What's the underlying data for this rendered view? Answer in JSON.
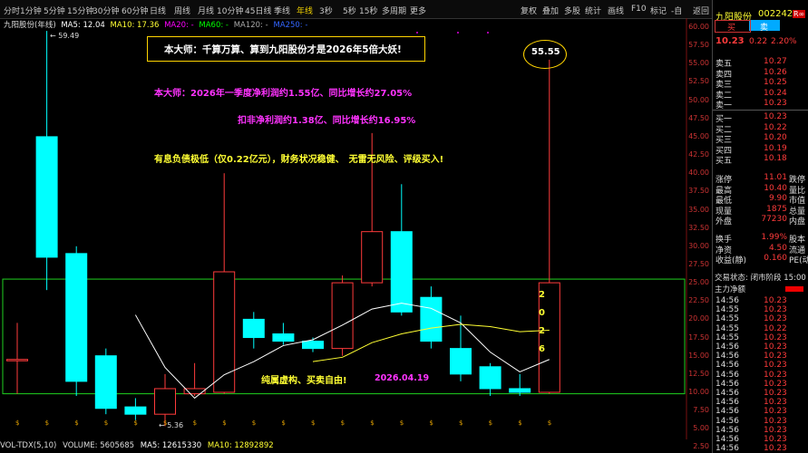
{
  "topbar": {
    "period_tabs": [
      "分时",
      "1分钟",
      "5分钟",
      "15分钟",
      "30分钟",
      "60分钟",
      "日线",
      "周线",
      "月线",
      "10分钟",
      "45日线",
      "季线",
      "年线",
      "3秒",
      "5秒",
      "15秒",
      "多周期",
      "更多"
    ],
    "active_tab": "年线",
    "tools": [
      "复权",
      "叠加",
      "多股",
      "统计",
      "画线",
      "F10",
      "标记",
      "-自",
      "返回"
    ]
  },
  "chart_info": {
    "stock": "九阳股份(年线)",
    "ma5": "MA5: 12.04",
    "ma10": "MA10: 17.36",
    "ma20": "MA20: -",
    "ma60": "MA60: -",
    "ma120": "MA120: -",
    "ma250": "MA250: -"
  },
  "annotations": {
    "headline": "本大师：千算万算、算到九阳股份才是2026年5倍大妖!",
    "line1": "本大师：2026年一季度净利润约1.55亿、同比增长约27.05%",
    "line2": "扣非净利润约1.38亿、同比增长约16.95%",
    "line3": "有息负债极低（仅0.22亿元），财务状况稳健、　无雷无风险、评级买入!",
    "bottom_left": "纯属虚构、买卖自由!",
    "bottom_date": "2026.04.19",
    "target": "55.55",
    "vertical_year": [
      "2",
      "0",
      "2",
      "6"
    ],
    "high_label": "59.49",
    "low_label": "5.36"
  },
  "y_axis": [
    "60.00",
    "57.50",
    "55.00",
    "52.50",
    "50.00",
    "47.50",
    "45.00",
    "42.50",
    "40.00",
    "37.50",
    "35.00",
    "32.50",
    "30.00",
    "27.50",
    "25.00",
    "22.50",
    "20.00",
    "17.50",
    "15.00",
    "12.50",
    "10.00",
    "7.50",
    "5.00",
    "2.50"
  ],
  "chart_data": {
    "type": "candlestick",
    "ylim": [
      2.5,
      60
    ],
    "candles": [
      {
        "o": 14.5,
        "c": 14.5,
        "h": 19.5,
        "l": 9.8
      },
      {
        "o": 45.0,
        "c": 28.5,
        "h": 59.49,
        "l": 24.0
      },
      {
        "o": 29.0,
        "c": 11.5,
        "h": 30.0,
        "l": 9.5
      },
      {
        "o": 15.0,
        "c": 7.8,
        "h": 16.0,
        "l": 7.0
      },
      {
        "o": 8.0,
        "c": 7.0,
        "h": 9.2,
        "l": 6.2
      },
      {
        "o": 7.0,
        "c": 10.5,
        "h": 12.5,
        "l": 5.36
      },
      {
        "o": 9.8,
        "c": 10.5,
        "h": 14.0,
        "l": 9.5
      },
      {
        "o": 10.0,
        "c": 26.5,
        "h": 40.0,
        "l": 9.8
      },
      {
        "o": 20.0,
        "c": 17.5,
        "h": 21.0,
        "l": 16.0
      },
      {
        "o": 18.0,
        "c": 17.0,
        "h": 19.5,
        "l": 16.5
      },
      {
        "o": 17.0,
        "c": 16.0,
        "h": 17.5,
        "l": 15.5
      },
      {
        "o": 16.0,
        "c": 25.0,
        "h": 26.0,
        "l": 15.0
      },
      {
        "o": 25.0,
        "c": 32.0,
        "h": 45.5,
        "l": 24.5
      },
      {
        "o": 32.0,
        "c": 21.0,
        "h": 38.5,
        "l": 20.5
      },
      {
        "o": 23.0,
        "c": 17.0,
        "h": 24.5,
        "l": 16.0
      },
      {
        "o": 16.0,
        "c": 12.5,
        "h": 20.5,
        "l": 11.5
      },
      {
        "o": 13.5,
        "c": 10.5,
        "h": 14.0,
        "l": 9.5
      },
      {
        "o": 10.5,
        "c": 10.0,
        "h": 12.5,
        "l": 9.5
      },
      {
        "o": 10.0,
        "c": 25.0,
        "h": 55.55,
        "l": 9.8
      }
    ],
    "ma5": [
      null,
      null,
      null,
      null,
      20.6,
      13.4,
      9.2,
      12.4,
      14.2,
      16.4,
      17.2,
      19.2,
      21.4,
      22.2,
      21.5,
      19.5,
      15.5,
      12.8,
      14.5
    ],
    "ma10": [
      null,
      null,
      null,
      null,
      null,
      null,
      null,
      null,
      null,
      null,
      14.2,
      14.8,
      16.8,
      18.0,
      18.8,
      19.3,
      19.0,
      18.3,
      18.5
    ],
    "colors": {
      "up": "#ff3b3b",
      "down": "#00ffff",
      "ma5": "#ffffff",
      "ma10": "#ffff33"
    }
  },
  "side": {
    "name": "九阳股份",
    "code": "002242",
    "icon": "R∞",
    "price": "10.23",
    "change": "0.22",
    "pct": "2.20%",
    "buy_btn": "买",
    "sell_btn": "卖",
    "asks": [
      [
        "卖五",
        "10.27"
      ],
      [
        "卖四",
        "10.26"
      ],
      [
        "卖三",
        "10.25"
      ],
      [
        "卖二",
        "10.24"
      ],
      [
        "卖一",
        "10.23"
      ]
    ],
    "bids": [
      [
        "买一",
        "10.23"
      ],
      [
        "买二",
        "10.22"
      ],
      [
        "买三",
        "10.20"
      ],
      [
        "买四",
        "10.19"
      ],
      [
        "买五",
        "10.18"
      ]
    ],
    "stats": [
      [
        "涨停",
        "11.01",
        "跌停"
      ],
      [
        "最高",
        "10.40",
        "量比"
      ],
      [
        "最低",
        "9.90",
        "市值"
      ],
      [
        "现量",
        "1875",
        "总量"
      ],
      [
        "外盘",
        "77230",
        "内盘"
      ]
    ],
    "stats2": [
      [
        "换手",
        "1.99%",
        "股本"
      ],
      [
        "净资",
        "4.50",
        "流通"
      ],
      [
        "收益(静)",
        "0.160",
        "PE(动)"
      ]
    ],
    "status": "交易状态: 闭市阶段 15:00",
    "net_label": "主力净额",
    "ticks": [
      [
        "14:56",
        "10.23"
      ],
      [
        "14:55",
        "10.23"
      ],
      [
        "14:55",
        "10.23"
      ],
      [
        "14:55",
        "10.22"
      ],
      [
        "14:55",
        "10.23"
      ],
      [
        "14:56",
        "10.23"
      ],
      [
        "14:56",
        "10.23"
      ],
      [
        "14:56",
        "10.23"
      ],
      [
        "14:56",
        "10.23"
      ],
      [
        "14:56",
        "10.23"
      ],
      [
        "14:56",
        "10.23"
      ],
      [
        "14:56",
        "10.23"
      ],
      [
        "14:56",
        "10.23"
      ],
      [
        "14:56",
        "10.23"
      ],
      [
        "14:56",
        "10.23"
      ],
      [
        "14:56",
        "10.23"
      ],
      [
        "14:56",
        "10.23"
      ]
    ]
  },
  "volume_row": {
    "label": "VOL-TDX(5,10)",
    "volume": "VOLUME: 5605685",
    "ma5": "MA5: 12615330",
    "ma10": "MA10: 12892892"
  }
}
